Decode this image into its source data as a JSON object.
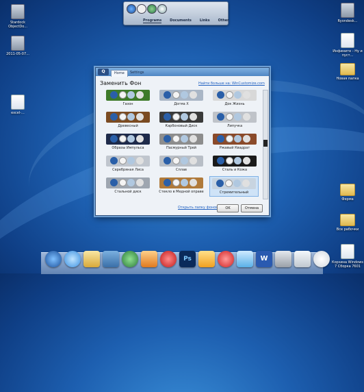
{
  "desktop_icons_left": [
    {
      "label": "Stardock ObjectDo...",
      "kind": "app"
    },
    {
      "label": "2011-05-07...",
      "kind": "app"
    },
    {
      "label": "excel-...",
      "kind": "doc"
    }
  ],
  "desktop_icons_right": [
    {
      "label": "Ryondesk...",
      "kind": "app"
    },
    {
      "label": "Инфините - Ну и пуст...",
      "kind": "doc"
    },
    {
      "label": "Новая папка",
      "kind": "folder"
    },
    {
      "label": "Ферма",
      "kind": "folder"
    },
    {
      "label": "Все рабочки",
      "kind": "folder"
    },
    {
      "label": "Корзина Windows 7 Сборка 7601",
      "kind": "doc"
    }
  ],
  "topdock": {
    "tabs": [
      "Programs",
      "Documents",
      "Links",
      "Other"
    ],
    "active_tab": "Programs"
  },
  "dialog": {
    "tabs": {
      "home": "Home",
      "settings": "Settings"
    },
    "logo": "Q",
    "heading": "Заменить Фон",
    "find_more_link": "Найти больше на: WinCustomize.com",
    "open_folder_link": "Открыть папку фонов",
    "ok_label": "OK",
    "cancel_label": "Отмена",
    "backgrounds": [
      {
        "name": "Газон",
        "color": "#3e7a2a"
      },
      {
        "name": "Догма Х",
        "color": "#a9b6c6"
      },
      {
        "name": "Док Жизнь",
        "color": "#d8d8d8"
      },
      {
        "name": "Древесный",
        "color": "#7b4b22"
      },
      {
        "name": "Карбоновый Диск",
        "color": "#3a3a3a"
      },
      {
        "name": "Липучка",
        "color": "#bfc3c9"
      },
      {
        "name": "Образы Импульса",
        "color": "#1e2a4a"
      },
      {
        "name": "Пасмурный Трей",
        "color": "#8d8d8d"
      },
      {
        "name": "Ржавый Квадрат",
        "color": "#8a4a2a"
      },
      {
        "name": "Серебряная Лиса",
        "color": "#c0c6ce"
      },
      {
        "name": "Сплав",
        "color": "#b8bec6"
      },
      {
        "name": "Сталь и Кожа",
        "color": "#1a1a1a"
      },
      {
        "name": "Стальной диск",
        "color": "#9ea6b0"
      },
      {
        "name": "Стекло в Медной оправе",
        "color": "#b07a3a"
      },
      {
        "name": "Стремительный",
        "color": "#c8d4e0"
      }
    ]
  },
  "taskbar_apps": [
    {
      "name": "Windows",
      "color": "#2a6fd0"
    },
    {
      "name": "Internet Explorer",
      "color": "#3a8fe0"
    },
    {
      "name": "Explorer",
      "color": "#e4c060"
    },
    {
      "name": "Network",
      "color": "#4c8a3a"
    },
    {
      "name": "Globe",
      "color": "#3aa060"
    },
    {
      "name": "Media",
      "color": "#e07a20"
    },
    {
      "name": "Opera",
      "color": "#d02020"
    },
    {
      "name": "Photoshop",
      "color": "#0a2a5a"
    },
    {
      "name": "VLC",
      "color": "#f0a020"
    },
    {
      "name": "Opera 2",
      "color": "#e02a2a"
    },
    {
      "name": "Weather",
      "color": "#5ab0e8"
    },
    {
      "name": "Word",
      "color": "#2a5ab0"
    },
    {
      "name": "Tools",
      "color": "#9aa0a8"
    },
    {
      "name": "Recycle",
      "color": "#c0c8d0"
    },
    {
      "name": "Clock",
      "color": "#f4f4f4"
    }
  ]
}
